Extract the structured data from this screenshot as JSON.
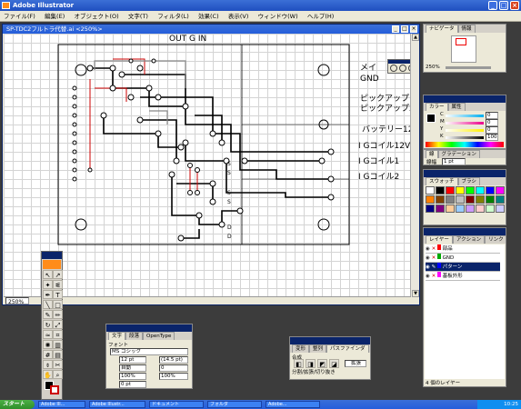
{
  "app": {
    "title": "Adobe Illustrator"
  },
  "menu": {
    "items": [
      "ファイル(F)",
      "編集(E)",
      "オブジェクト(O)",
      "文字(T)",
      "フィルタ(L)",
      "効果(C)",
      "表示(V)",
      "ウィンドウ(W)",
      "ヘルプ(H)"
    ]
  },
  "document": {
    "title": "SP-TDC2フルトラ代替.ai <250%>",
    "zoom": "250%"
  },
  "artwork": {
    "out_label": "OUT G IN",
    "labels": [
      "メイ",
      "GND",
      "ピックアップ1",
      "ピックアップ2",
      "バッテリー12",
      "I Gコイル12V",
      "I Gコイル1",
      "I Gコイル2"
    ],
    "s_marks": [
      "S",
      "S",
      "S",
      "S",
      "S",
      "S",
      "S",
      "S"
    ],
    "d_marks": [
      "D",
      "D"
    ]
  },
  "navigator": {
    "tabs": [
      "ナビゲータ",
      "情報"
    ],
    "zoom": "250%"
  },
  "color_panel": {
    "tabs": [
      "カラー",
      "属性"
    ],
    "channels": [
      "C",
      "M",
      "Y",
      "K"
    ],
    "values": [
      "0",
      "0",
      "0",
      "100"
    ],
    "unit": "%"
  },
  "stroke_panel": {
    "tabs": [
      "線",
      "グラデーション"
    ],
    "label": "線幅",
    "value": "1 pt"
  },
  "swatch_panel": {
    "tabs": [
      "スウォッチ",
      "ブラシ"
    ],
    "colors": [
      "#ffffff",
      "#000000",
      "#ff0000",
      "#ffff00",
      "#00ff00",
      "#00ffff",
      "#0000ff",
      "#ff00ff",
      "#ff8000",
      "#804000",
      "#808080",
      "#c0c0c0",
      "#800000",
      "#808000",
      "#008000",
      "#008080",
      "#000080",
      "#800080",
      "#ffcc99",
      "#99ccff",
      "#cc99ff",
      "#ffcccc",
      "#ccffcc",
      "#ccccff"
    ]
  },
  "layer_panel": {
    "tabs": [
      "レイヤー",
      "アクション",
      "リンク"
    ],
    "layers": [
      "部品",
      "GND",
      "パターン",
      "基板外形"
    ],
    "footer": "4 個のレイヤー"
  },
  "character_panel": {
    "tabs": [
      "文字",
      "段落",
      "OpenType"
    ],
    "font_label": "フォント",
    "font": "MS ゴシック",
    "size": "12 pt",
    "leading": "(14.5 pt)",
    "kerning": "自動",
    "tracking": "0",
    "v_scale": "100%",
    "h_scale": "100%",
    "baseline": "0 pt"
  },
  "pathfinder_panel": {
    "tabs": [
      "変形",
      "整列",
      "パスファインダ"
    ],
    "shape_label": "合成",
    "divide_label": "分割/拡張/切り抜き",
    "expand_btn": "拡張"
  },
  "taskbar": {
    "start": "スタート",
    "items": [
      "Adobe Ill...",
      "Adobe Illustr...",
      "ドキュメント",
      "フォルダ",
      "Adobe..."
    ],
    "clock": "10:25"
  }
}
